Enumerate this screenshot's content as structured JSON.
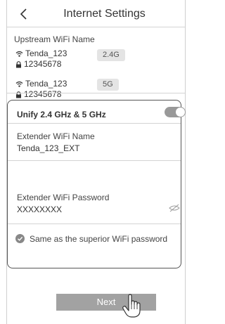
{
  "header": {
    "title": "Internet Settings",
    "back_icon": "chevron-left-icon"
  },
  "upstream": {
    "label": "Upstream WiFi Name",
    "networks": [
      {
        "ssid": "Tenda_123",
        "password": "12345678",
        "band": "2.4G"
      },
      {
        "ssid": "Tenda_123",
        "password": "12345678",
        "band": "5G"
      }
    ]
  },
  "extender": {
    "unify_label": "Unify 2.4 GHz & 5 GHz",
    "unify_enabled": true,
    "name_label": "Extender WiFi Name",
    "name_value": "Tenda_123_EXT",
    "password_label": "Extender WiFi Password",
    "password_value": "XXXXXXXX",
    "same_password_label": "Same as the superior WiFi password",
    "same_password_checked": true
  },
  "footer": {
    "next_label": "Next"
  },
  "colors": {
    "button": "#a2a2a2",
    "toggle": "#999999",
    "badge_bg": "#e4e4e4"
  }
}
